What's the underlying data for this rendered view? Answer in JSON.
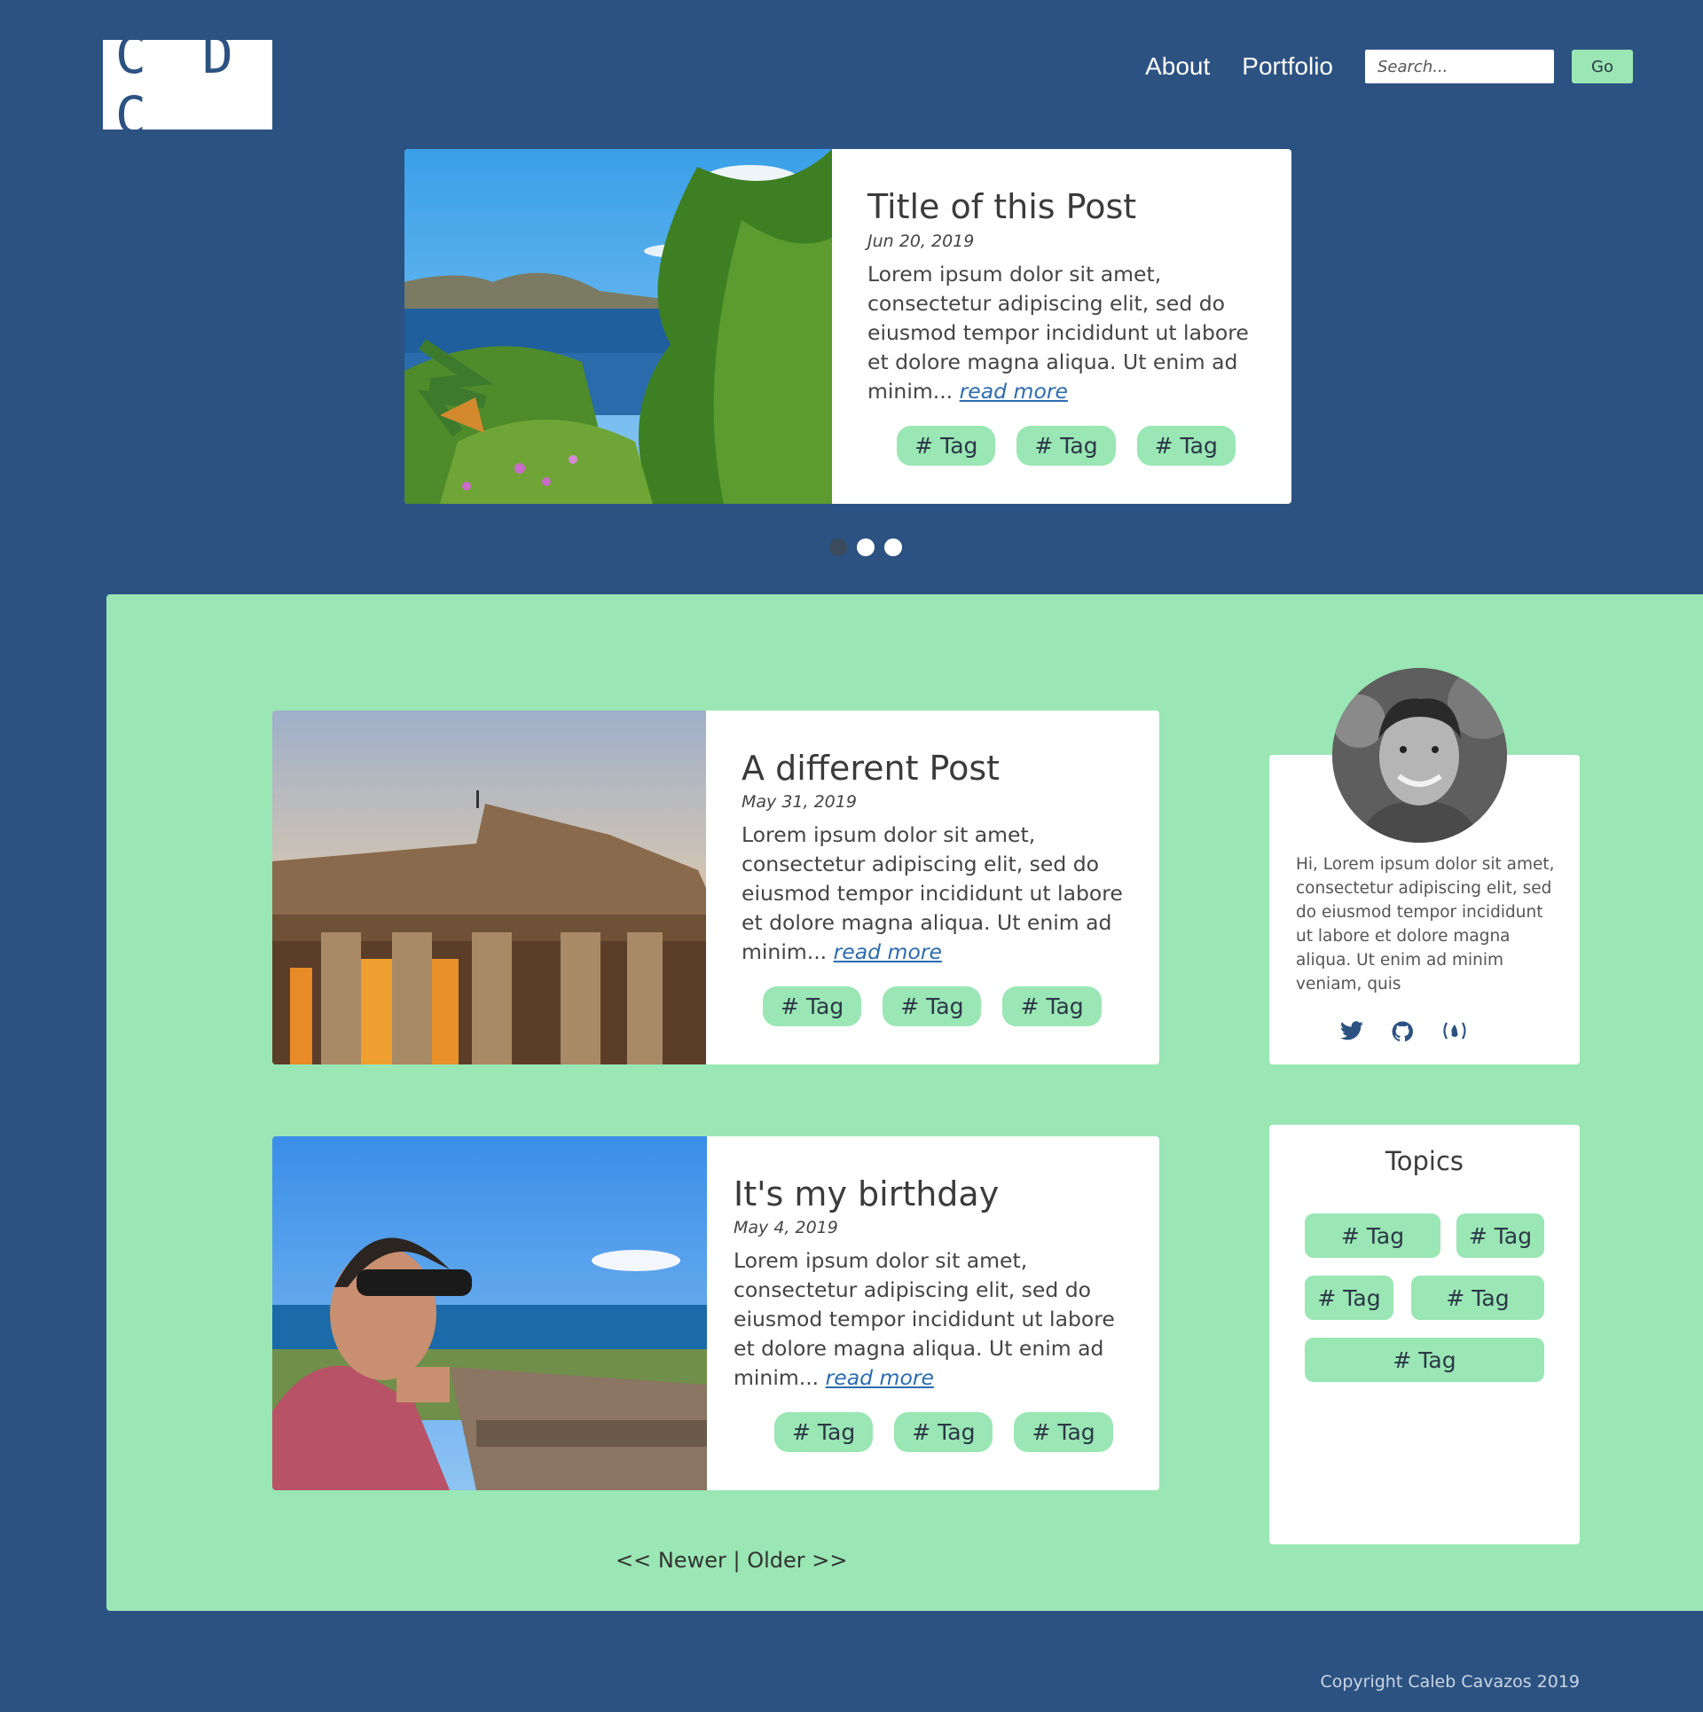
{
  "header": {
    "logo": "C D C",
    "nav": [
      "About",
      "Portfolio"
    ],
    "search_placeholder": "Search...",
    "go_label": "Go"
  },
  "featured": {
    "title": "Title of this Post",
    "date": "Jun 20, 2019",
    "excerpt": "Lorem ipsum dolor sit amet, consectetur adipiscing elit, sed do eiusmod tempor incididunt ut labore et dolore magna aliqua. Ut enim ad minim...",
    "read_more": "read more",
    "tags": [
      "# Tag",
      "# Tag",
      "# Tag"
    ]
  },
  "posts": [
    {
      "title": "A different Post",
      "date": "May 31, 2019",
      "excerpt": "Lorem ipsum dolor sit amet, consectetur adipiscing elit, sed do eiusmod tempor incididunt ut labore et dolore magna aliqua. Ut enim ad minim...",
      "read_more": "read more",
      "tags": [
        "# Tag",
        "# Tag",
        "# Tag"
      ]
    },
    {
      "title": "It's my birthday",
      "date": "May 4, 2019",
      "excerpt": "Lorem ipsum dolor sit amet, consectetur adipiscing elit, sed do eiusmod tempor incididunt ut labore et dolore magna aliqua. Ut enim ad minim...",
      "read_more": "read more",
      "tags": [
        "# Tag",
        "# Tag",
        "# Tag"
      ]
    }
  ],
  "pager": {
    "newer": "<< Newer",
    "separator": "|",
    "older": "Older >>"
  },
  "about": {
    "text": "Hi, Lorem ipsum dolor sit amet, consectetur adipiscing elit, sed do eiusmod tempor incididunt ut labore et dolore magna aliqua. Ut enim ad minim veniam, quis",
    "social_icons": [
      "twitter-icon",
      "github-icon",
      "freecodecamp-icon"
    ]
  },
  "topics": {
    "title": "Topics",
    "tags": [
      "# Tag",
      "# Tag",
      "# Tag",
      "# Tag",
      "# Tag"
    ]
  },
  "footer": {
    "copyright": "Copyright Caleb Cavazos 2019"
  },
  "colors": {
    "background": "#2c5282",
    "accent": "#9ae6b4",
    "link": "#2b6cb0"
  }
}
